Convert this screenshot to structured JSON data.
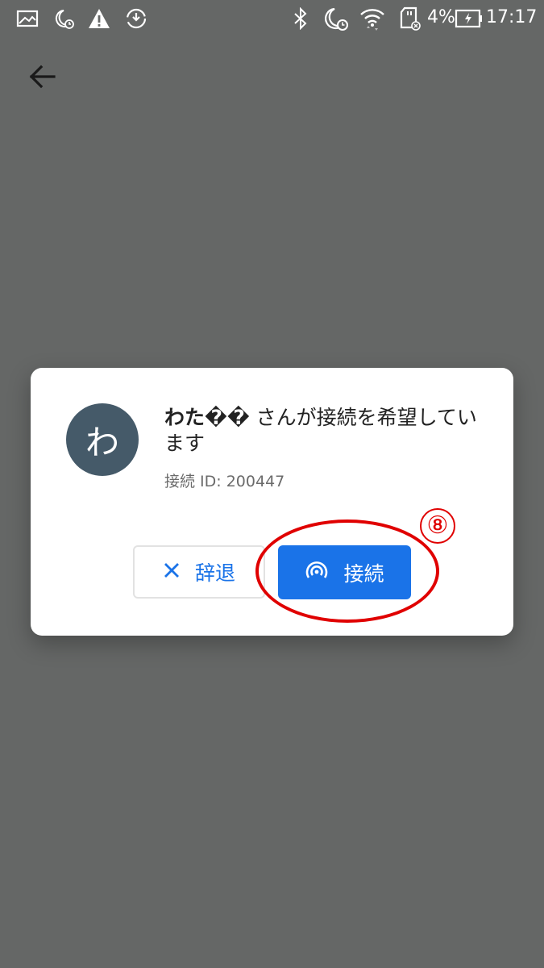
{
  "status_bar": {
    "battery": "4%",
    "time": "17:17",
    "left_icons": [
      "image-icon",
      "do-not-disturb-alarm-icon",
      "warning-icon",
      "sync-icon"
    ],
    "right_icons": [
      "bluetooth-icon",
      "do-not-disturb-alarm-icon",
      "wifi-icon",
      "sd-card-icon",
      "battery-charging-icon"
    ]
  },
  "nav": {
    "back_icon": "back-arrow-icon"
  },
  "dialog": {
    "avatar_initial": "わ",
    "requester_name": "わた��",
    "request_suffix": " さんが接続を希望しています",
    "connection_id": "接続 ID: 200447",
    "decline_label": "辞退",
    "connect_label": "接続",
    "decline_icon": "close-icon",
    "connect_icon": "connect-signal-icon"
  },
  "annotation": {
    "step_number": "⑧"
  },
  "colors": {
    "overlay_background": "#656766",
    "accent": "#1a73e8",
    "avatar": "#455a69",
    "annotation": "#e00000"
  }
}
